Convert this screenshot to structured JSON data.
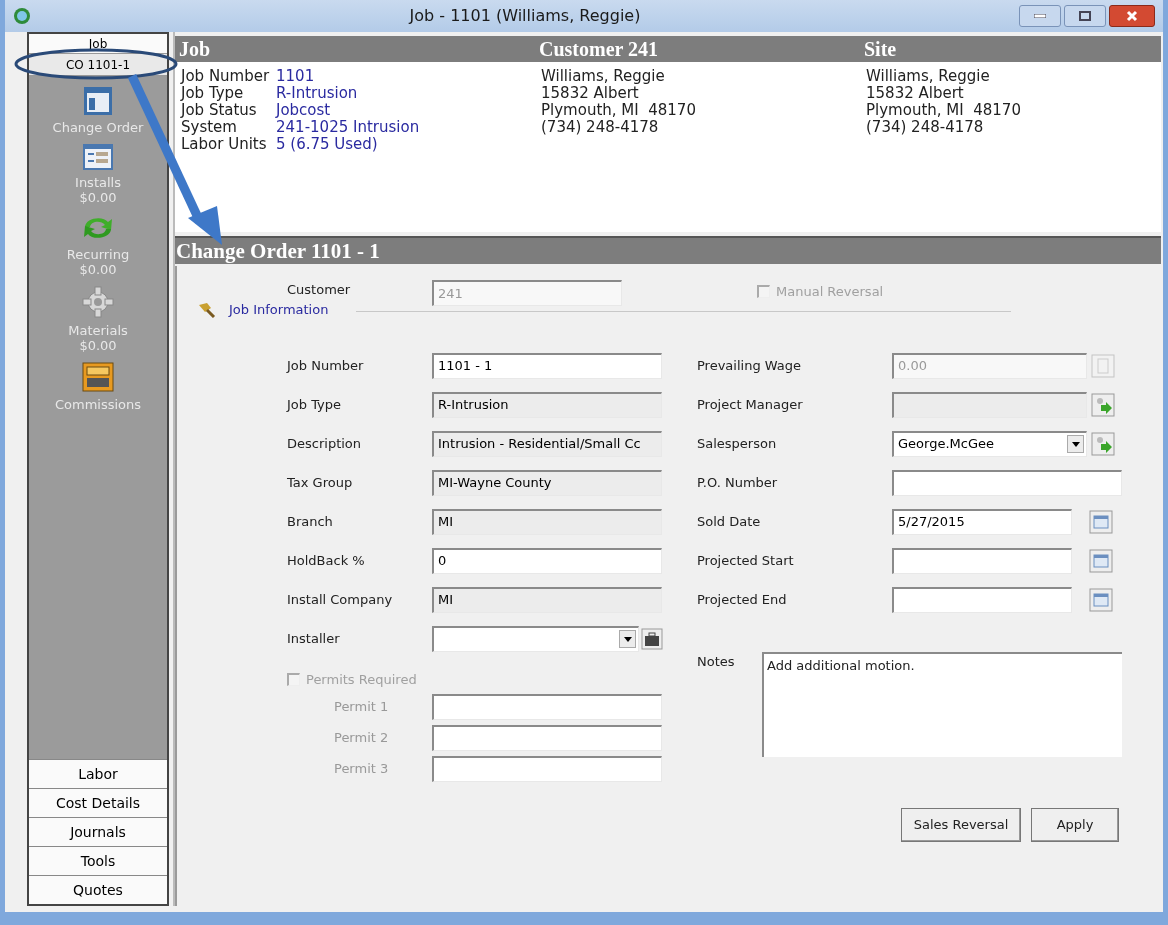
{
  "window": {
    "title": "Job - 1101 (Williams, Reggie)"
  },
  "sidebar": {
    "top_tabs": [
      {
        "label": "Job",
        "selected": false
      },
      {
        "label": "CO 1101-1",
        "selected": true
      }
    ],
    "panel_items": [
      {
        "kind": "form",
        "label": "Change Order"
      },
      {
        "kind": "list",
        "label": "Installs",
        "amount": "$0.00"
      },
      {
        "kind": "recycle",
        "label": "Recurring",
        "amount": "$0.00"
      },
      {
        "kind": "gear",
        "label": "Materials",
        "amount": "$0.00"
      },
      {
        "kind": "drawer",
        "label": "Commissions"
      }
    ],
    "bottom_tabs": [
      "Labor",
      "Cost Details",
      "Journals",
      "Tools",
      "Quotes"
    ]
  },
  "header": {
    "job": {
      "title": "Job",
      "fields": [
        {
          "label": "Job Number",
          "value": "1101"
        },
        {
          "label": "Job Type",
          "value": "R-Intrusion"
        },
        {
          "label": "Job Status",
          "value": "Jobcost"
        },
        {
          "label": "System",
          "value": "241-1025 Intrusion"
        },
        {
          "label": "Labor Units",
          "value": "5 (6.75 Used)"
        }
      ]
    },
    "customer": {
      "title": "Customer 241",
      "lines": [
        "Williams, Reggie",
        "15832 Albert",
        "Plymouth, MI  48170",
        "(734) 248-4178"
      ]
    },
    "site": {
      "title": "Site",
      "lines": [
        "Williams, Reggie",
        "15832 Albert",
        "Plymouth, MI  48170",
        "(734) 248-4178"
      ]
    }
  },
  "section_title": "Change Order 1101 - 1",
  "form": {
    "customer": {
      "label": "Customer",
      "value": "241"
    },
    "manual_reversal": {
      "label": "Manual Reversal",
      "checked": false
    },
    "group_label": "Job Information",
    "left_fields": [
      {
        "label": "Job Number",
        "value": "1101 - 1",
        "kind": "input"
      },
      {
        "label": "Job Type",
        "value": "R-Intrusion",
        "kind": "readonly"
      },
      {
        "label": "Description",
        "value": "Intrusion - Residential/Small Cc",
        "kind": "readonly"
      },
      {
        "label": "Tax Group",
        "value": "MI-Wayne County",
        "kind": "readonly"
      },
      {
        "label": "Branch",
        "value": "MI",
        "kind": "readonly"
      },
      {
        "label": "HoldBack  %",
        "value": "0",
        "kind": "input"
      },
      {
        "label": "Install Company",
        "value": "MI",
        "kind": "readonly"
      },
      {
        "label": "Installer",
        "kind": "dropdown",
        "button": {
          "kind": "toolbox"
        }
      }
    ],
    "permits_required": {
      "label": "Permits Required",
      "checked": false
    },
    "permits": [
      {
        "label": "Permit 1"
      },
      {
        "label": "Permit 2"
      },
      {
        "label": "Permit 3"
      }
    ],
    "right_fields": [
      {
        "label": "Prevailing Wage",
        "value": "0.00",
        "kind": "disabled",
        "button": {
          "kind": "calculator"
        }
      },
      {
        "label": "Project Manager",
        "kind": "readonly",
        "button": {
          "kind": "lookup"
        }
      },
      {
        "label": "Salesperson",
        "value": "George.McGee",
        "kind": "dropdown",
        "button": {
          "kind": "lookup"
        }
      },
      {
        "label": "P.O. Number",
        "kind": "input"
      },
      {
        "label": "Sold Date",
        "value": "5/27/2015",
        "kind": "input",
        "button": {
          "kind": "calendar"
        }
      },
      {
        "label": "Projected Start",
        "kind": "input",
        "button": {
          "kind": "calendar"
        }
      },
      {
        "label": "Projected End",
        "kind": "input",
        "button": {
          "kind": "calendar"
        }
      }
    ],
    "notes": {
      "label": "Notes",
      "value": "Add additional motion."
    },
    "buttons": [
      "Sales Reversal",
      "Apply"
    ]
  }
}
